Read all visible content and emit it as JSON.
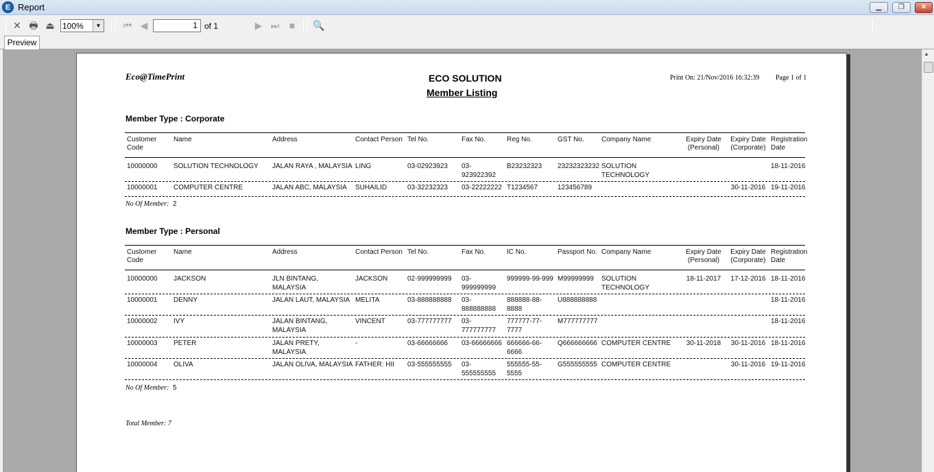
{
  "window": {
    "title": "Report",
    "app_icon_letter": "E",
    "controls": [
      "minimize",
      "maximize",
      "close"
    ]
  },
  "toolbar": {
    "zoom_value": "100%",
    "page_current": "1",
    "page_of": "of 1",
    "icons": [
      "close-icon",
      "print-icon",
      "export-icon",
      "first-page-icon",
      "prev-page-icon",
      "next-page-icon",
      "last-page-icon",
      "stop-icon",
      "find-icon"
    ]
  },
  "tabs": [
    {
      "label": "Preview"
    }
  ],
  "report": {
    "brand": "Eco@TimePrint",
    "company": "ECO SOLUTION",
    "title": "Member Listing",
    "print_on": "Print On: 21/Nov/2016 16:32:39",
    "page_info": "Page 1 of 1",
    "corporate": {
      "heading": "Member Type : Corporate",
      "headers": [
        "Customer Code",
        "Name",
        "Address",
        "Contact Person",
        "Tel No.",
        "Fax No.",
        "Reg No.",
        "GST No.",
        "Company Name",
        "Expiry Date (Personal)",
        "Expiry Date (Corporate)",
        "Registration Date"
      ],
      "rows": [
        [
          "10000000",
          "SOLUTION TECHNOLOGY",
          "JALAN RAYA , MALAYSIA",
          "LING",
          "03-02923923",
          "03-923922392",
          "B23232323",
          "23232323232",
          "SOLUTION TECHNOLOGY",
          "",
          "",
          "18-11-2016"
        ],
        [
          "10000001",
          "COMPUTER CENTRE",
          "JALAN ABC, MALAYSIA",
          "SUHAILID",
          "03-32232323",
          "03-22222222",
          "T1234567",
          "123456789",
          "",
          "",
          "30-11-2016",
          "19-11-2016"
        ]
      ],
      "count_label": "No Of Member:",
      "count_value": "2"
    },
    "personal": {
      "heading": "Member Type : Personal",
      "headers": [
        "Customer Code",
        "Name",
        "Address",
        "Contact Person",
        "Tel No.",
        "Fax No.",
        "IC No.",
        "Passport No.",
        "Company Name",
        "Expiry Date (Personal)",
        "Expiry Date (Corporate)",
        "Registration Date"
      ],
      "rows": [
        [
          "10000000",
          "JACKSON",
          "JLN BINTANG, MALAYSIA",
          "JACKSON",
          "02-999999999",
          "03-999999999",
          "999999-99-999",
          "M99999999",
          "SOLUTION TECHNOLOGY",
          "18-11-2017",
          "17-12-2016",
          "18-11-2016"
        ],
        [
          "10000001",
          "DENNY",
          "JALAN LAUT, MALAYSIA",
          "MELITA",
          "03-888888888",
          "03-888888888",
          "888888-88-8888",
          "U888888888",
          "",
          "",
          "",
          "18-11-2016"
        ],
        [
          "10000002",
          "IVY",
          "JALAN BINTANG, MALAYSIA",
          "VINCENT",
          "03-777777777",
          "03-777777777",
          "777777-77-7777",
          "M777777777",
          "",
          "",
          "",
          "18-11-2016"
        ],
        [
          "10000003",
          "PETER",
          "JALAN PRETY, MALAYSIA",
          "-",
          "03-66666666",
          "03-66666666",
          "666666-66-6666",
          "Q666666666",
          "COMPUTER CENTRE",
          "30-11-2018",
          "30-11-2016",
          "18-11-2016"
        ],
        [
          "10000004",
          "OLIVA",
          "JALAN OLIVA, MALAYSIA",
          "FATHER: HII",
          "03-555555555",
          "03-555555555",
          "555555-55-5555",
          "G555555555",
          "COMPUTER CENTRE",
          "",
          "30-11-2016",
          "19-11-2016"
        ]
      ],
      "count_label": "No Of Member:",
      "count_value": "5"
    },
    "total_label": "Total Member:",
    "total_value": "7"
  }
}
